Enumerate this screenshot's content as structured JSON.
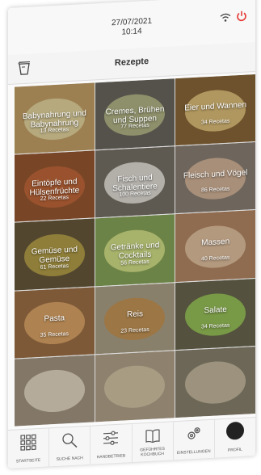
{
  "status": {
    "date": "27/07/2021",
    "time": "10:14"
  },
  "header": {
    "title": "Rezepte"
  },
  "colors": {
    "power": "#e53935",
    "accent": "#222222"
  },
  "categories": [
    {
      "name": "Babynahrung und Babynahrung",
      "count": "13 Recetas",
      "bg": "#c9a46a",
      "dish": "#e8d9a0"
    },
    {
      "name": "Cremes, Brühen und Suppen",
      "count": "77 Recetas",
      "bg": "#6e6a60",
      "dish": "#b7b98a"
    },
    {
      "name": "Eier und Wannen",
      "count": "34 Recetas",
      "bg": "#8c6a3a",
      "dish": "#e2c27a"
    },
    {
      "name": "Eintöpfe und Hülsenfrüchte",
      "count": "22 Recetas",
      "bg": "#9a5a32",
      "dish": "#c46a3a"
    },
    {
      "name": "Fisch und Schalentiere",
      "count": "100 Recetas",
      "bg": "#7a7468",
      "dish": "#e6e2da"
    },
    {
      "name": "Fleisch und Vögel",
      "count": "86 Recetas",
      "bg": "#8e8378",
      "dish": "#d8b89c"
    },
    {
      "name": "Gemüse und Gemüse",
      "count": "61 Recetas",
      "bg": "#6a5a3c",
      "dish": "#b8a24a"
    },
    {
      "name": "Getränke und Cocktails",
      "count": "56 Recetas",
      "bg": "#8aa85a",
      "dish": "#d6e48a"
    },
    {
      "name": "Massen",
      "count": "40 Recetas",
      "bg": "#b88a66",
      "dish": "#e6c4a2"
    },
    {
      "name": "Pasta",
      "count": "35 Recetas",
      "bg": "#a07248",
      "dish": "#e0a868"
    },
    {
      "name": "Reis",
      "count": "23 Recetas",
      "bg": "#b0a48a",
      "dish": "#c89858"
    },
    {
      "name": "Salate",
      "count": "34 Recetas",
      "bg": "#6c6a50",
      "dish": "#9ac45a"
    },
    {
      "name": "",
      "count": "",
      "bg": "#a89a86",
      "dish": "#e8dcc6"
    },
    {
      "name": "",
      "count": "",
      "bg": "#b6a68e",
      "dish": "#d8c8a8"
    },
    {
      "name": "",
      "count": "",
      "bg": "#8c8470",
      "dish": "#c8bca0"
    }
  ],
  "nav": [
    {
      "label": "STARTSEITE",
      "icon": "grid-icon"
    },
    {
      "label": "SUCHE NACH",
      "icon": "search-icon"
    },
    {
      "label": "HANDBETRIEB",
      "icon": "sliders-icon"
    },
    {
      "label": "GEFÜHRTES KOCHBUCH",
      "icon": "book-icon"
    },
    {
      "label": "EINSTELLUNGEN",
      "icon": "gears-icon"
    },
    {
      "label": "PROFIL",
      "icon": "profile-icon"
    }
  ]
}
